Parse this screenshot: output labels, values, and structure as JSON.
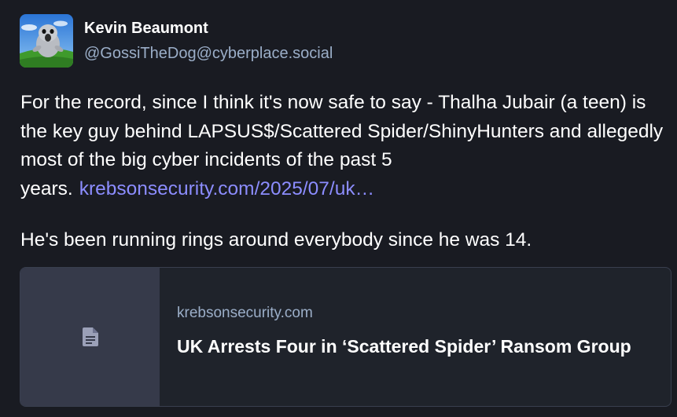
{
  "author": {
    "display_name": "Kevin Beaumont",
    "handle": "@GossiTheDog@cyberplace.social",
    "avatar_icon": "seal-avatar-icon"
  },
  "content": {
    "paragraph1_text": "For the record, since I think it's now safe to say - Thalha Jubair (a teen) is the key guy behind LAPSUS$/Scattered Spider/ShinyHunters and allegedly most of the big cyber incidents of the past 5 years.",
    "paragraph1_link": "krebsonsecurity.com/2025/07/uk…",
    "paragraph2_text": "He's been running rings around everybody since he was 14."
  },
  "link_card": {
    "host": "krebsonsecurity.com",
    "title": "UK Arrests Four in ‘Scattered Spider’ Ransom Group",
    "thumbnail_icon": "document-icon"
  },
  "colors": {
    "background": "#191b22",
    "link": "#8c8dff",
    "secondary_text": "#9baec8",
    "card_border": "#393f4f",
    "card_thumb": "#363a4a"
  }
}
